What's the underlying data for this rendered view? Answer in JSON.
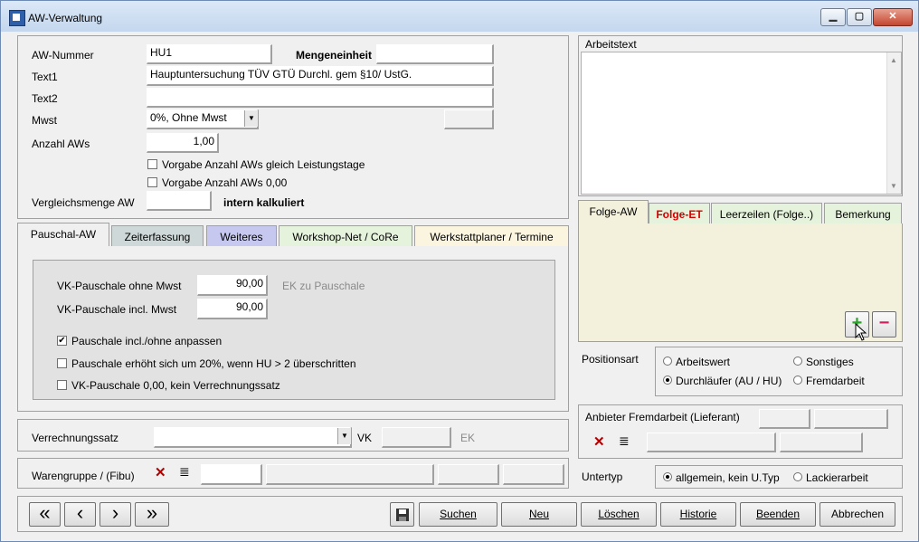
{
  "window": {
    "title": "AW-Verwaltung",
    "minimize": "▁",
    "maximize": "▢",
    "close": "✕"
  },
  "header": {
    "aw_nummer_label": "AW-Nummer",
    "aw_nummer_value": "HU1",
    "mengeneinheit_label": "Mengeneinheit",
    "mengeneinheit_value": "",
    "text1_label": "Text1",
    "text1_value": "Hauptuntersuchung TÜV GTÜ Durchl. gem §10/ UstG.",
    "text2_label": "Text2",
    "text2_value": "",
    "mwst_label": "Mwst",
    "mwst_value": "0%, Ohne Mwst",
    "anzahl_label": "Anzahl AWs",
    "anzahl_value": "1,00",
    "check1_label": "Vorgabe Anzahl AWs gleich Leistungstage",
    "check2_label": "Vorgabe Anzahl AWs 0,00",
    "vergleich_label": "Vergleichsmenge AW",
    "vergleich_value": "",
    "intern_label": "intern kalkuliert"
  },
  "arbeitstext": {
    "label": "Arbeitstext",
    "value": ""
  },
  "left_tabs": [
    "Pauschal-AW",
    "Zeiterfassung",
    "Weiteres",
    "Workshop-Net / CoRe",
    "Werkstattplaner / Termine"
  ],
  "pauschal": {
    "vk_ohne_label": "VK-Pauschale ohne Mwst",
    "vk_ohne_value": "90,00",
    "ek_label": "EK zu Pauschale",
    "vk_incl_label": "VK-Pauschale incl. Mwst",
    "vk_incl_value": "90,00",
    "opt1_label": "Pauschale incl./ohne anpassen",
    "opt2_label": "Pauschale erhöht sich um 20%, wenn HU > 2 überschritten",
    "opt3_label": "VK-Pauschale 0,00, kein Verrechnungssatz"
  },
  "verrechnung": {
    "label": "Verrechnungssatz",
    "vk_label": "VK",
    "ek_label": "EK"
  },
  "warengruppe": {
    "label": "Warengruppe / (Fibu)"
  },
  "right_tabs": [
    "Folge-AW",
    "Folge-ET",
    "Leerzeilen (Folge..)",
    "Bemerkung"
  ],
  "positionsart": {
    "label": "Positionsart",
    "opt_arbeitswert": "Arbeitswert",
    "opt_sonstiges": "Sonstiges",
    "opt_durchlaeufer": "Durchläufer (AU / HU)",
    "opt_fremdarbeit": "Fremdarbeit"
  },
  "anbieter": {
    "label": "Anbieter Fremdarbeit (Lieferant)"
  },
  "untertyp": {
    "label": "Untertyp",
    "opt_allgemein": "allgemein, kein U.Typ",
    "opt_lackier": "Lackierarbeit"
  },
  "footer": {
    "first": "«",
    "prev": "‹",
    "next": "›",
    "last": "»",
    "suchen": "Suchen",
    "neu": "Neu",
    "loeschen": "Löschen",
    "historie": "Historie",
    "beenden": "Beenden",
    "abbrechen": "Abbrechen"
  },
  "colors": {
    "folge_et": "#d40000",
    "zeiterfassung_tab": "#cfd8d8",
    "weiteres_tab": "#c7c8f0",
    "workshop_tab": "#e6f3dc",
    "werkstatt_tab": "#fbf5e0",
    "right_panel": "#f3f1dc",
    "add": "#2aa52a",
    "remove": "#d02060"
  }
}
